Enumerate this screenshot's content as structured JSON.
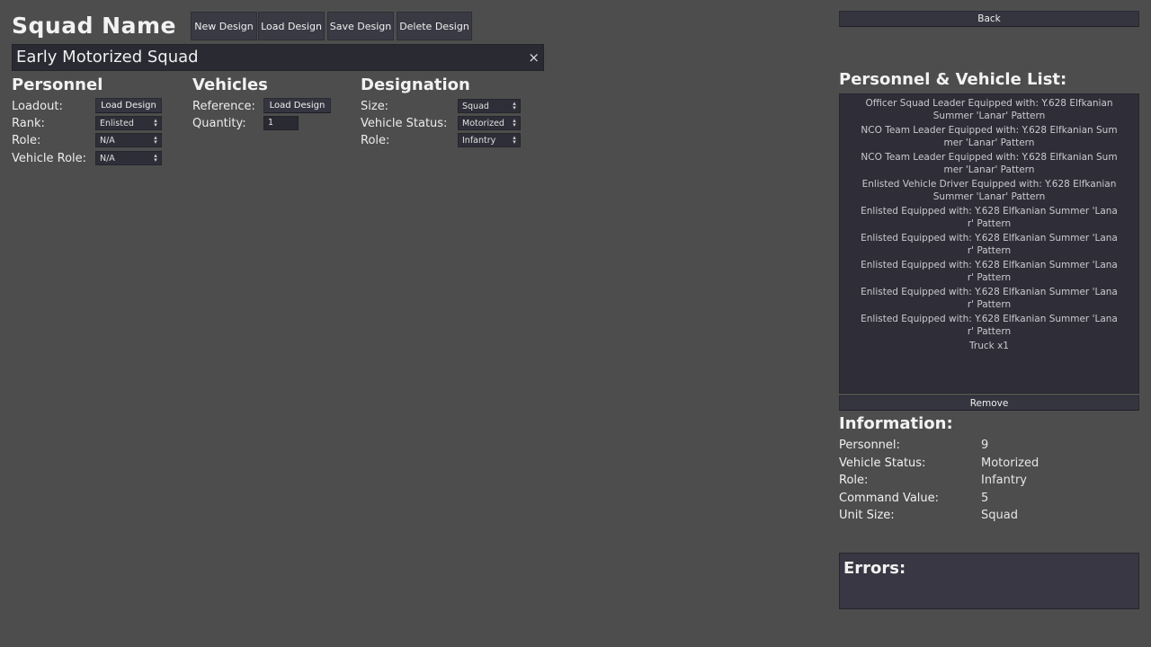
{
  "header": {
    "title": "Squad Name",
    "buttons": [
      "New Design",
      "Load Design",
      "Save Design",
      "Delete Design"
    ],
    "name_value": "Early Motorized Squad",
    "clear_glyph": "×"
  },
  "personnel": {
    "heading": "Personnel",
    "loadout_label": "Loadout:",
    "loadout_button": "Load Design",
    "rank_label": "Rank:",
    "rank_value": "Enlisted",
    "role_label": "Role:",
    "role_value": "N/A",
    "vehicle_role_label": "Vehicle Role:",
    "vehicle_role_value": "N/A"
  },
  "vehicles": {
    "heading": "Vehicles",
    "reference_label": "Reference:",
    "reference_button": "Load Design",
    "quantity_label": "Quantity:",
    "quantity_value": "1"
  },
  "designation": {
    "heading": "Designation",
    "size_label": "Size:",
    "size_value": "Squad",
    "vehicle_status_label": "Vehicle Status:",
    "vehicle_status_value": "Motorized",
    "role_label": "Role:",
    "role_value": "Infantry"
  },
  "right": {
    "back_button": "Back",
    "list_heading": "Personnel & Vehicle List:",
    "list_items": [
      [
        "Officer Squad Leader  Equipped with: Y.628 Elfkanian",
        "Summer 'Lanar' Pattern"
      ],
      [
        "NCO Team Leader  Equipped with: Y.628 Elfkanian Sum",
        "mer 'Lanar' Pattern"
      ],
      [
        "NCO Team Leader  Equipped with: Y.628 Elfkanian Sum",
        "mer 'Lanar' Pattern"
      ],
      [
        "Enlisted Vehicle Driver  Equipped with: Y.628 Elfkanian",
        "Summer 'Lanar' Pattern"
      ],
      [
        "Enlisted  Equipped with: Y.628 Elfkanian Summer 'Lana",
        "r' Pattern"
      ],
      [
        "Enlisted  Equipped with: Y.628 Elfkanian Summer 'Lana",
        "r' Pattern"
      ],
      [
        "Enlisted  Equipped with: Y.628 Elfkanian Summer 'Lana",
        "r' Pattern"
      ],
      [
        "Enlisted  Equipped with: Y.628 Elfkanian Summer 'Lana",
        "r' Pattern"
      ],
      [
        "Enlisted  Equipped with: Y.628 Elfkanian Summer 'Lana",
        "r' Pattern"
      ],
      [
        "Truck x1"
      ]
    ],
    "remove_button": "Remove",
    "info_heading": "Information:",
    "info": [
      {
        "label": "Personnel:",
        "value": "9"
      },
      {
        "label": "Vehicle Status:",
        "value": "Motorized"
      },
      {
        "label": "Role:",
        "value": "Infantry"
      },
      {
        "label": "Command Value:",
        "value": "5"
      },
      {
        "label": "Unit Size:",
        "value": "Squad"
      }
    ],
    "errors_heading": "Errors:"
  }
}
